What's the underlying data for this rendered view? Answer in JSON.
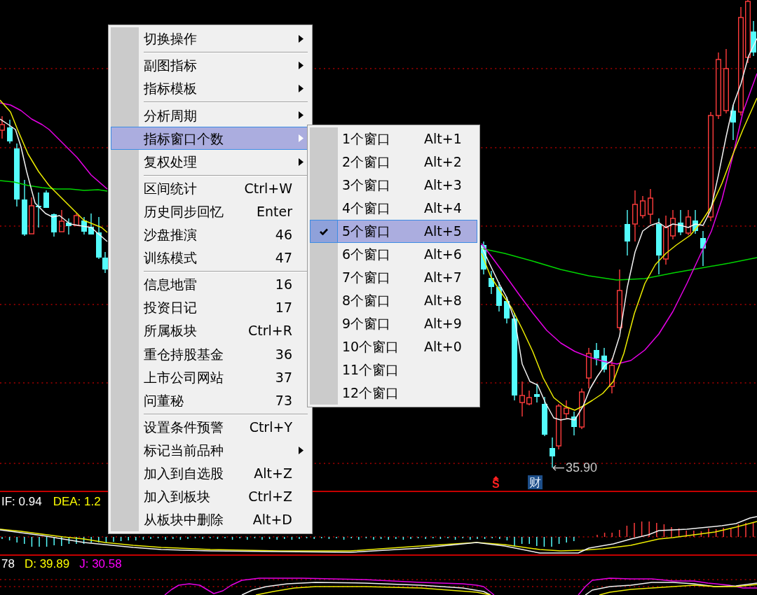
{
  "price_panel": {
    "low_price_label": "35.90",
    "markers": [
      {
        "kind": "signal",
        "text": "S"
      },
      {
        "kind": "badge",
        "text": "财"
      }
    ]
  },
  "macd_panel": {
    "labels": [
      {
        "text": "IF: 0.94",
        "color": "#ffffff"
      },
      {
        "text": "DEA: 1.2",
        "color": "#ffff00"
      }
    ]
  },
  "kdj_panel": {
    "labels": [
      {
        "text": "78",
        "color": "#ffffff"
      },
      {
        "text": "D: 39.89",
        "color": "#ffff00"
      },
      {
        "text": "J: 30.58",
        "color": "#ff00ff"
      }
    ]
  },
  "context_menu": {
    "groups": [
      {
        "items": [
          {
            "label": "切换操作",
            "has_submenu": true,
            "selected": false
          }
        ]
      },
      {
        "items": [
          {
            "label": "副图指标",
            "has_submenu": true,
            "selected": false
          },
          {
            "label": "指标模板",
            "has_submenu": true,
            "selected": false
          }
        ]
      },
      {
        "items": [
          {
            "label": "分析周期",
            "has_submenu": true,
            "selected": false
          },
          {
            "label": "指标窗口个数",
            "has_submenu": true,
            "selected": true
          },
          {
            "label": "复权处理",
            "has_submenu": true,
            "selected": false
          }
        ]
      },
      {
        "items": [
          {
            "label": "区间统计",
            "shortcut": "Ctrl+W",
            "has_submenu": false,
            "selected": false
          },
          {
            "label": "历史同步回忆",
            "shortcut": "Enter",
            "has_submenu": false,
            "selected": false
          },
          {
            "label": "沙盘推演",
            "shortcut": "46",
            "has_submenu": false,
            "selected": false
          },
          {
            "label": "训练模式",
            "shortcut": "47",
            "has_submenu": false,
            "selected": false
          }
        ]
      },
      {
        "items": [
          {
            "label": "信息地雷",
            "shortcut": "16",
            "has_submenu": false,
            "selected": false
          },
          {
            "label": "投资日记",
            "shortcut": "17",
            "has_submenu": false,
            "selected": false
          },
          {
            "label": "所属板块",
            "shortcut": "Ctrl+R",
            "has_submenu": false,
            "selected": false
          },
          {
            "label": "重仓持股基金",
            "shortcut": "36",
            "has_submenu": false,
            "selected": false
          },
          {
            "label": "上市公司网站",
            "shortcut": "37",
            "has_submenu": false,
            "selected": false
          },
          {
            "label": "问董秘",
            "shortcut": "73",
            "has_submenu": false,
            "selected": false
          }
        ]
      },
      {
        "items": [
          {
            "label": "设置条件预警",
            "shortcut": "Ctrl+Y",
            "has_submenu": false,
            "selected": false
          },
          {
            "label": "标记当前品种",
            "has_submenu": true,
            "selected": false
          },
          {
            "label": "加入到自选股",
            "shortcut": "Alt+Z",
            "has_submenu": false,
            "selected": false
          },
          {
            "label": "加入到板块",
            "shortcut": "Ctrl+Z",
            "has_submenu": false,
            "selected": false
          },
          {
            "label": "从板块中删除",
            "shortcut": "Alt+D",
            "has_submenu": false,
            "selected": false
          }
        ]
      }
    ]
  },
  "submenu": {
    "items": [
      {
        "label": "1个窗口",
        "shortcut": "Alt+1",
        "checked": false,
        "selected": false
      },
      {
        "label": "2个窗口",
        "shortcut": "Alt+2",
        "checked": false,
        "selected": false
      },
      {
        "label": "3个窗口",
        "shortcut": "Alt+3",
        "checked": false,
        "selected": false
      },
      {
        "label": "4个窗口",
        "shortcut": "Alt+4",
        "checked": false,
        "selected": false
      },
      {
        "label": "5个窗口",
        "shortcut": "Alt+5",
        "checked": true,
        "selected": true
      },
      {
        "label": "6个窗口",
        "shortcut": "Alt+6",
        "checked": false,
        "selected": false
      },
      {
        "label": "7个窗口",
        "shortcut": "Alt+7",
        "checked": false,
        "selected": false
      },
      {
        "label": "8个窗口",
        "shortcut": "Alt+8",
        "checked": false,
        "selected": false
      },
      {
        "label": "9个窗口",
        "shortcut": "Alt+9",
        "checked": false,
        "selected": false
      },
      {
        "label": "10个窗口",
        "shortcut": "Alt+0",
        "checked": false,
        "selected": false
      },
      {
        "label": "11个窗口",
        "checked": false,
        "selected": false
      },
      {
        "label": "12个窗口",
        "checked": false,
        "selected": false
      }
    ]
  }
}
